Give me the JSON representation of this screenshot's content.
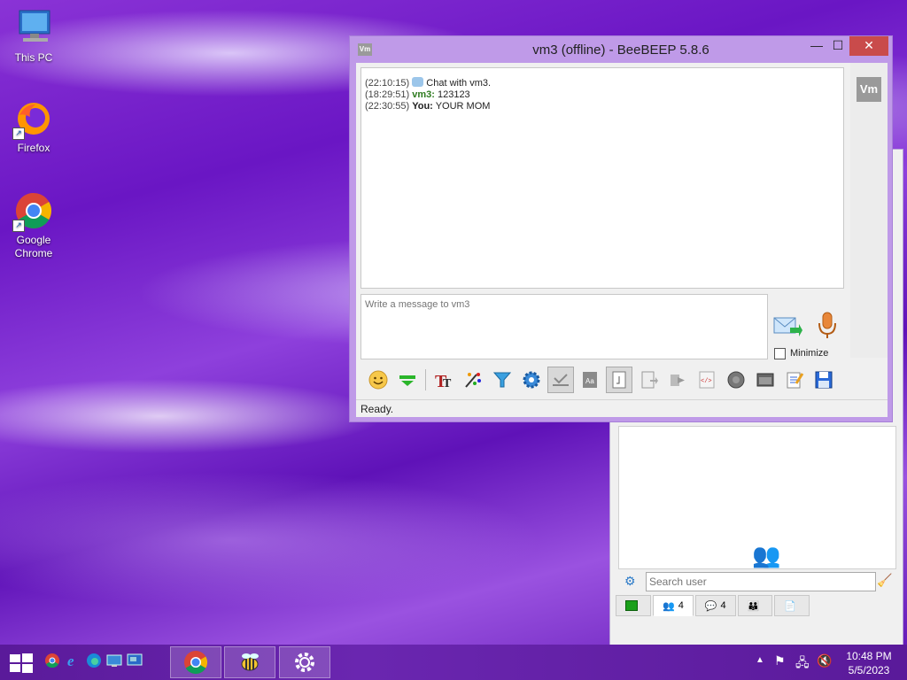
{
  "desktop": {
    "icons": [
      {
        "label": "This PC"
      },
      {
        "label": "Firefox"
      },
      {
        "label": "Google\nChrome"
      }
    ]
  },
  "chat_window": {
    "title": "vm3 (offline) - BeeBEEP 5.8.6",
    "app_icon_text": "Vm",
    "avatar_text": "Vm",
    "messages": [
      {
        "time": "(22:10:15)",
        "nick": "",
        "text": "Chat with vm3."
      },
      {
        "time": "(18:29:51)",
        "nick": "vm3:",
        "text": "123123"
      },
      {
        "time": "(22:30:55)",
        "nick": "You:",
        "text": "YOUR MOM"
      }
    ],
    "input_placeholder": "Write a message to vm3",
    "minimize_label": "Minimize",
    "status": "Ready."
  },
  "main_window": {
    "search_placeholder": "Search user",
    "tabs": [
      {
        "label": ""
      },
      {
        "label": "4"
      },
      {
        "label": "4"
      },
      {
        "label": ""
      },
      {
        "label": ""
      }
    ]
  },
  "taskbar": {
    "clock_time": "10:48 PM",
    "clock_date": "5/5/2023"
  },
  "colors": {
    "accent": "#bf9ae8",
    "close_button": "#c94b4b",
    "vm3_nick": "#2d7a1e"
  }
}
